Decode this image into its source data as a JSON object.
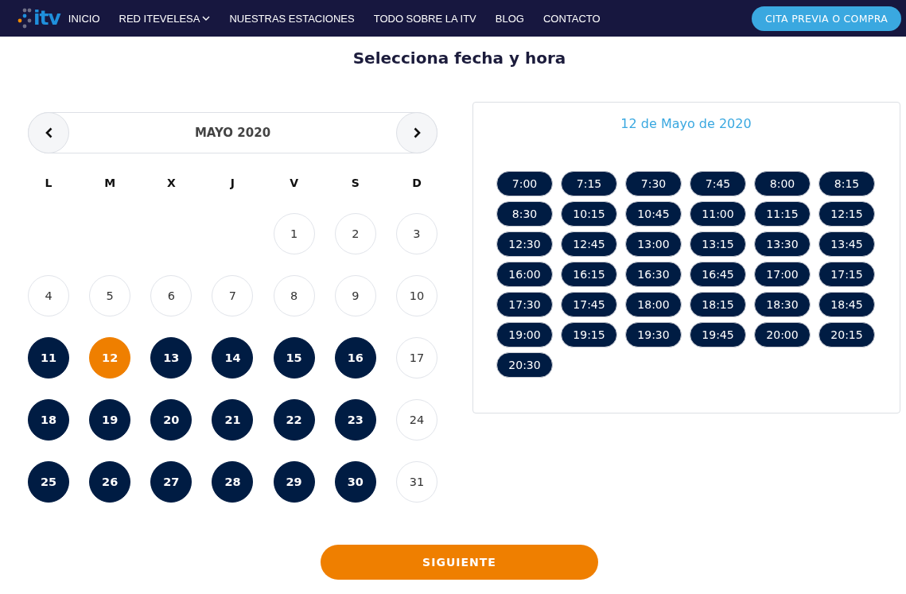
{
  "header": {
    "logo": {
      "wordmark": "itv"
    },
    "nav_items": [
      {
        "label": "INICIO",
        "has_menu": false
      },
      {
        "label": "RED ITEVELESA",
        "has_menu": true
      },
      {
        "label": "NUESTRAS ESTACIONES",
        "has_menu": false
      },
      {
        "label": "TODO SOBRE LA ITV",
        "has_menu": false
      },
      {
        "label": "BLOG",
        "has_menu": false
      },
      {
        "label": "CONTACTO",
        "has_menu": false
      }
    ],
    "cta_button": "CITA PREVIA O COMPRA"
  },
  "title": "Selecciona fecha y hora",
  "calendar": {
    "month": "MAYO 2020",
    "weekdays": [
      "L",
      "M",
      "X",
      "J",
      "V",
      "S",
      "D"
    ],
    "weeks": [
      {
        "days": [
          {
            "day": "1",
            "available": false,
            "selected": false
          },
          {
            "day": "2",
            "available": false,
            "selected": false
          },
          {
            "day": "3",
            "available": false,
            "selected": false
          }
        ]
      },
      {
        "days": [
          {
            "day": "4",
            "available": false,
            "selected": false
          },
          {
            "day": "5",
            "available": false,
            "selected": false
          },
          {
            "day": "6",
            "available": false,
            "selected": false
          },
          {
            "day": "7",
            "available": false,
            "selected": false
          },
          {
            "day": "8",
            "available": false,
            "selected": false
          },
          {
            "day": "9",
            "available": false,
            "selected": false
          },
          {
            "day": "10",
            "available": false,
            "selected": false
          }
        ]
      },
      {
        "days": [
          {
            "day": "11",
            "available": true,
            "selected": false
          },
          {
            "day": "12",
            "available": true,
            "selected": true
          },
          {
            "day": "13",
            "available": true,
            "selected": false
          },
          {
            "day": "14",
            "available": true,
            "selected": false
          },
          {
            "day": "15",
            "available": true,
            "selected": false
          },
          {
            "day": "16",
            "available": true,
            "selected": false
          },
          {
            "day": "17",
            "available": false,
            "selected": false
          }
        ]
      },
      {
        "days": [
          {
            "day": "18",
            "available": true,
            "selected": false
          },
          {
            "day": "19",
            "available": true,
            "selected": false
          },
          {
            "day": "20",
            "available": true,
            "selected": false
          },
          {
            "day": "21",
            "available": true,
            "selected": false
          },
          {
            "day": "22",
            "available": true,
            "selected": false
          },
          {
            "day": "23",
            "available": true,
            "selected": false
          },
          {
            "day": "24",
            "available": false,
            "selected": false
          }
        ]
      },
      {
        "days": [
          {
            "day": "25",
            "available": true,
            "selected": false
          },
          {
            "day": "26",
            "available": true,
            "selected": false
          },
          {
            "day": "27",
            "available": true,
            "selected": false
          },
          {
            "day": "28",
            "available": true,
            "selected": false
          },
          {
            "day": "29",
            "available": true,
            "selected": false
          },
          {
            "day": "30",
            "available": true,
            "selected": false
          },
          {
            "day": "31",
            "available": false,
            "selected": false
          }
        ]
      }
    ]
  },
  "time_panel": {
    "date": "12 de Mayo de 2020",
    "slots": [
      "7:00",
      "7:15",
      "7:30",
      "7:45",
      "8:00",
      "8:15",
      "8:30",
      "10:15",
      "10:45",
      "11:00",
      "11:15",
      "12:15",
      "12:30",
      "12:45",
      "13:00",
      "13:15",
      "13:30",
      "13:45",
      "16:00",
      "16:15",
      "16:30",
      "16:45",
      "17:00",
      "17:15",
      "17:30",
      "17:45",
      "18:00",
      "18:15",
      "18:30",
      "18:45",
      "19:00",
      "19:15",
      "19:30",
      "19:45",
      "20:00",
      "20:15",
      "20:30"
    ]
  },
  "next_button": "SIGUIENTE"
}
